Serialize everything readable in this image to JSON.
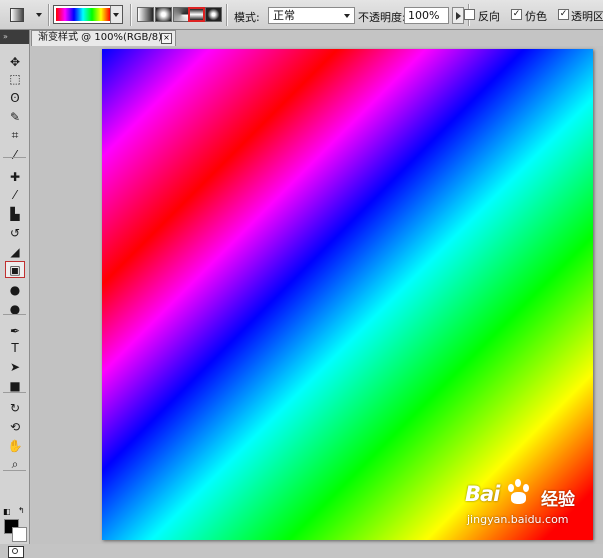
{
  "options": {
    "mode_label": "模式:",
    "mode_value": "正常",
    "opacity_label": "不透明度:",
    "opacity_value": "100%",
    "reverse_label": "反向",
    "dither_label": "仿色",
    "transparency_label": "透明区",
    "reverse_checked": false,
    "dither_checked": true,
    "transparency_checked": true,
    "gradient_types": [
      "linear",
      "radial",
      "angle",
      "reflected",
      "diamond"
    ],
    "selected_gradient_type": "reflected"
  },
  "document": {
    "tab_title": "渐变样式 @ 100%(RGB/8) *",
    "close_glyph": "×",
    "gradient_stops": [
      "#0000ff",
      "#ff00ff",
      "#ff0000",
      "#ff00ff",
      "#0000ff",
      "#00ffff",
      "#00ff00",
      "#ffff00",
      "#ff0000"
    ]
  },
  "toolbox": {
    "header": "»",
    "tools": [
      {
        "name": "move-tool",
        "glyph": "✥"
      },
      {
        "name": "marquee-tool",
        "glyph": "⬚"
      },
      {
        "name": "lasso-tool",
        "glyph": "ʘ"
      },
      {
        "name": "quick-selection-tool",
        "glyph": "✎"
      },
      {
        "name": "crop-tool",
        "glyph": "⌗"
      },
      {
        "name": "eyedropper-tool",
        "glyph": "⁄"
      },
      {
        "name": "healing-brush-tool",
        "glyph": "✚"
      },
      {
        "name": "brush-tool",
        "glyph": "⁄"
      },
      {
        "name": "clone-stamp-tool",
        "glyph": "▙"
      },
      {
        "name": "history-brush-tool",
        "glyph": "↺"
      },
      {
        "name": "eraser-tool",
        "glyph": "◢"
      },
      {
        "name": "gradient-tool",
        "glyph": "▣"
      },
      {
        "name": "blur-tool",
        "glyph": "●"
      },
      {
        "name": "dodge-tool",
        "glyph": "●"
      },
      {
        "name": "pen-tool",
        "glyph": "✒"
      },
      {
        "name": "type-tool",
        "glyph": "T"
      },
      {
        "name": "path-selection-tool",
        "glyph": "➤"
      },
      {
        "name": "shape-tool",
        "glyph": "■"
      },
      {
        "name": "3d-rotate-tool",
        "glyph": "↻"
      },
      {
        "name": "3d-orbit-tool",
        "glyph": "⟲"
      },
      {
        "name": "hand-tool",
        "glyph": "✋"
      },
      {
        "name": "zoom-tool",
        "glyph": "⌕"
      }
    ],
    "selected_tool": "gradient-tool",
    "foreground_color": "#000000",
    "background_color": "#ffffff"
  },
  "watermark": {
    "logo": "Bai",
    "logo_tail": "百",
    "sub": "经验",
    "url": "jingyan.baidu.com"
  }
}
